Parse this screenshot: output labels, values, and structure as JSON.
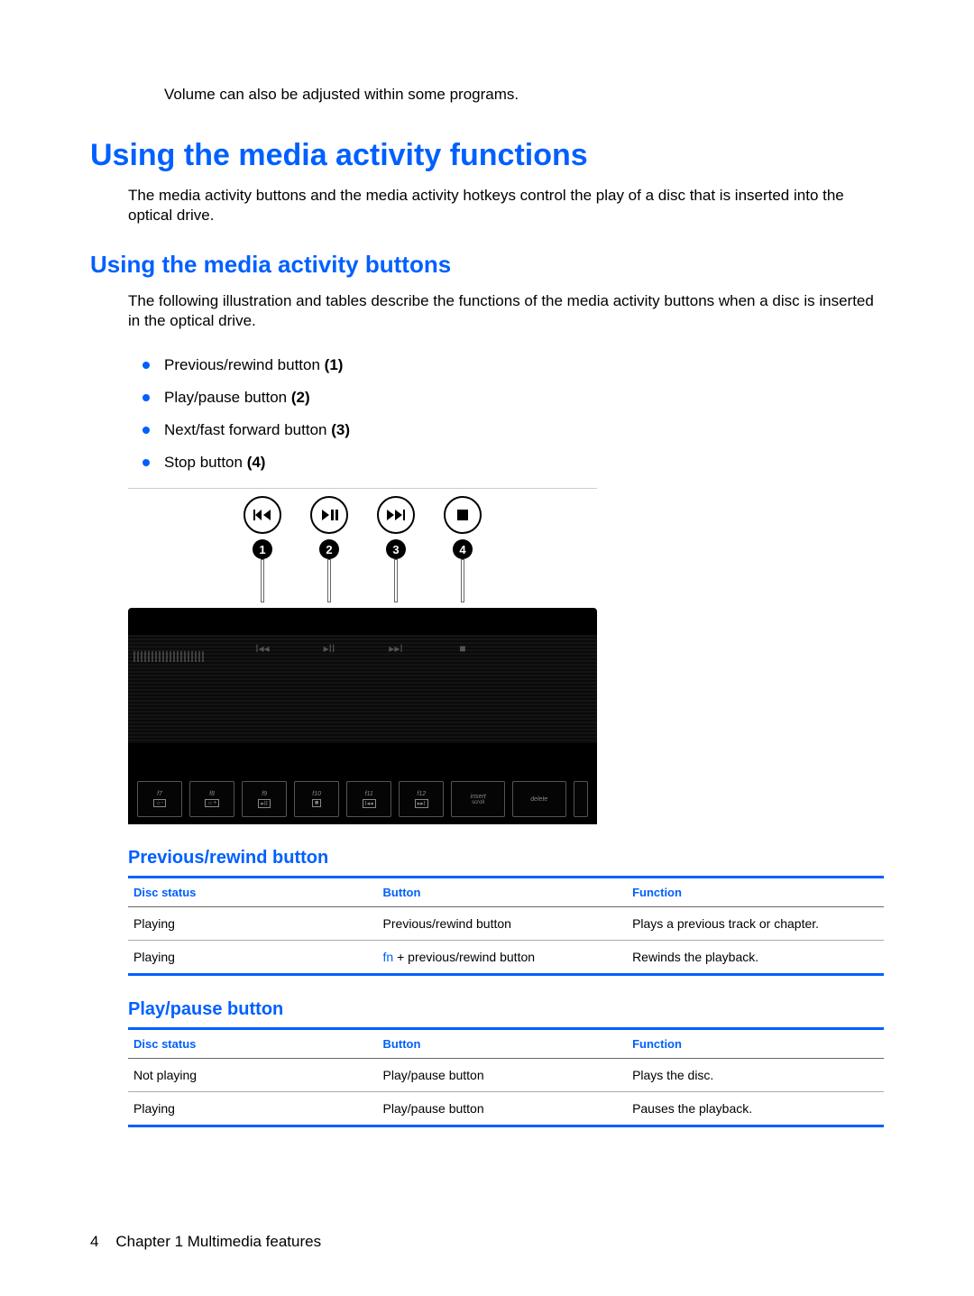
{
  "intro": "Volume can also be adjusted within some programs.",
  "h1": "Using the media activity functions",
  "p1": "The media activity buttons and the media activity hotkeys control the play of a disc that is inserted into the optical drive.",
  "h2": "Using the media activity buttons",
  "p2": "The following illustration and tables describe the functions of the media activity buttons when a disc is inserted in the optical drive.",
  "bullets": [
    {
      "text": "Previous/rewind button ",
      "num": "(1)"
    },
    {
      "text": "Play/pause button ",
      "num": "(2)"
    },
    {
      "text": "Next/fast forward button ",
      "num": "(3)"
    },
    {
      "text": "Stop button ",
      "num": "(4)"
    }
  ],
  "callouts": [
    "1",
    "2",
    "3",
    "4"
  ],
  "keys": [
    "f7",
    "f8",
    "f9",
    "f10",
    "f11",
    "f12",
    "insert",
    "delete"
  ],
  "section1": {
    "title": "Previous/rewind button",
    "headers": [
      "Disc status",
      "Button",
      "Function"
    ],
    "rows": [
      {
        "status": "Playing",
        "btn_plain": "Previous/rewind button",
        "btn_prefix": "",
        "func": "Plays a previous track or chapter."
      },
      {
        "status": "Playing",
        "btn_plain": " + previous/rewind button",
        "btn_prefix": "fn",
        "func": "Rewinds the playback."
      }
    ]
  },
  "section2": {
    "title": "Play/pause button",
    "headers": [
      "Disc status",
      "Button",
      "Function"
    ],
    "rows": [
      {
        "status": "Not playing",
        "btn_plain": "Play/pause button",
        "btn_prefix": "",
        "func": "Plays the disc."
      },
      {
        "status": "Playing",
        "btn_plain": "Play/pause button",
        "btn_prefix": "",
        "func": "Pauses the playback."
      }
    ]
  },
  "footer": {
    "page": "4",
    "chapter": "Chapter 1   Multimedia features"
  }
}
